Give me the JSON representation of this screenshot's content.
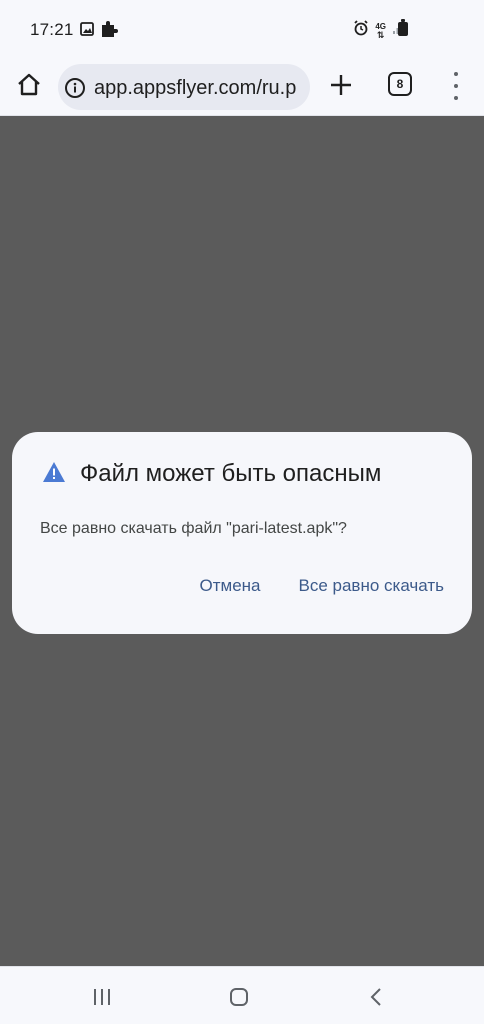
{
  "status_bar": {
    "time": "17:21",
    "icons_left": [
      "image-icon",
      "puzzle-icon"
    ],
    "icons_right": [
      "alarm-icon",
      "4g-icon",
      "signal-icon",
      "battery-icon"
    ],
    "network_label": "4G"
  },
  "browser": {
    "url": "app.appsflyer.com/ru.p",
    "tab_count": "8"
  },
  "dialog": {
    "title": "Файл может быть опасным",
    "message": "Все равно скачать файл \"pari-latest.apk\"?",
    "cancel_label": "Отмена",
    "confirm_label": "Все равно скачать",
    "warning_color": "#4b7ad3"
  },
  "nav_bar": {
    "buttons": [
      "recents-icon",
      "home-icon",
      "back-icon"
    ]
  }
}
